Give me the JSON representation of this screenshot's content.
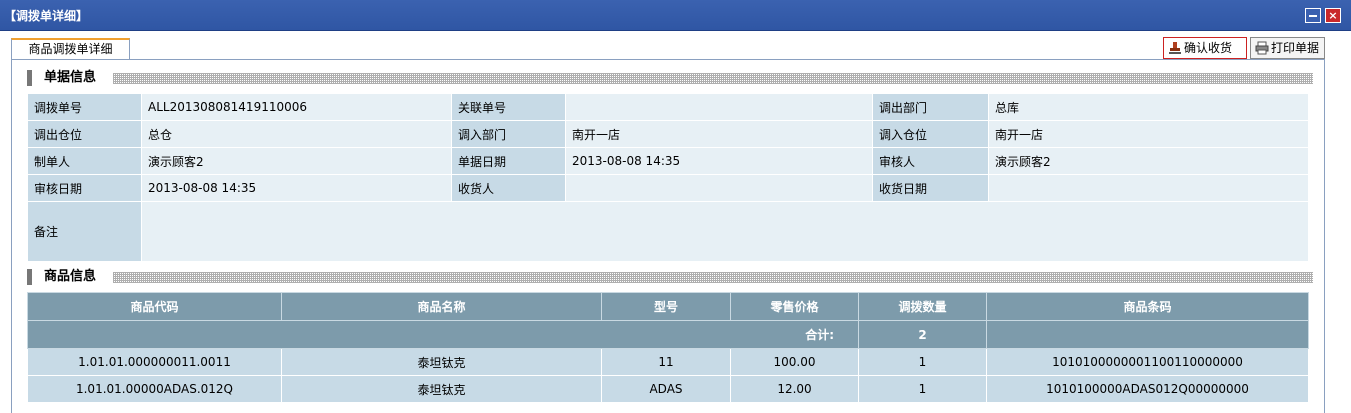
{
  "window": {
    "title": "【调拨单详细】"
  },
  "tab": {
    "label": "商品调拨单详细"
  },
  "toolbar": {
    "confirm_label": "确认收货",
    "print_label": "打印单据"
  },
  "sections": {
    "info": "单据信息",
    "goods": "商品信息"
  },
  "info": {
    "rows": [
      [
        {
          "k": "调拨单号",
          "v": "ALL201308081419110006"
        },
        {
          "k": "关联单号",
          "v": ""
        },
        {
          "k": "调出部门",
          "v": "总库"
        }
      ],
      [
        {
          "k": "调出仓位",
          "v": "总仓"
        },
        {
          "k": "调入部门",
          "v": "南开一店"
        },
        {
          "k": "调入仓位",
          "v": "南开一店"
        }
      ],
      [
        {
          "k": "制单人",
          "v": "演示顾客2"
        },
        {
          "k": "单据日期",
          "v": "2013-08-08 14:35"
        },
        {
          "k": "审核人",
          "v": "演示顾客2"
        }
      ],
      [
        {
          "k": "审核日期",
          "v": "2013-08-08 14:35"
        },
        {
          "k": "收货人",
          "v": ""
        },
        {
          "k": "收货日期",
          "v": ""
        }
      ]
    ],
    "remark": {
      "k": "备注",
      "v": ""
    }
  },
  "goods": {
    "headers": [
      "商品代码",
      "商品名称",
      "型号",
      "零售价格",
      "调拨数量",
      "商品条码"
    ],
    "summary": {
      "label": "合计:",
      "qty": "2"
    },
    "rows": [
      [
        "1.01.01.000000011.0011",
        "泰坦钛克",
        "11",
        "100.00",
        "1",
        "1010100000001100110000000"
      ],
      [
        "1.01.01.00000ADAS.012Q",
        "泰坦钛克",
        "ADAS",
        "12.00",
        "1",
        "1010100000ADAS012Q00000000"
      ]
    ]
  },
  "colors": {
    "titlebar": "#2f56a4",
    "header": "#7d9bab",
    "key_cell": "#c7dae6",
    "value_cell": "#e7f0f5",
    "tab_accent": "#f0a030"
  }
}
